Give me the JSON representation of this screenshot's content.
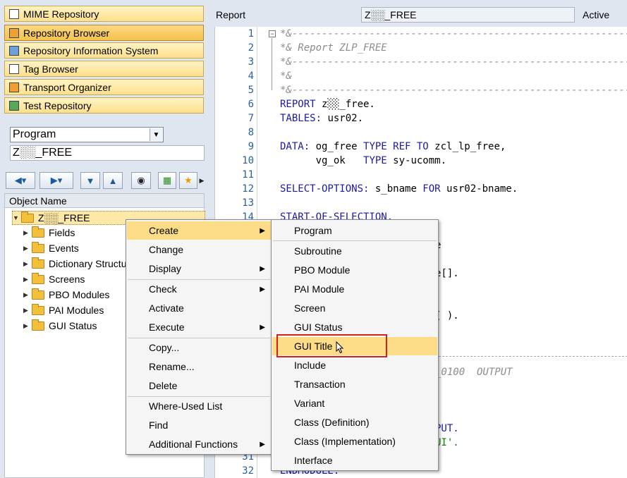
{
  "nav_buttons": [
    {
      "label": "MIME Repository",
      "icon": "mime-icon"
    },
    {
      "label": "Repository Browser",
      "icon": "tree-icon"
    },
    {
      "label": "Repository Information System",
      "icon": "info-system-icon"
    },
    {
      "label": "Tag Browser",
      "icon": "tag-icon"
    },
    {
      "label": "Transport Organizer",
      "icon": "truck-icon"
    },
    {
      "label": "Test Repository",
      "icon": "test-icon"
    }
  ],
  "object_selector": {
    "type_value": "Program",
    "name_value": "Z░░_FREE"
  },
  "tree": {
    "header": "Object Name",
    "root": "Z░░_FREE",
    "nodes": [
      "Fields",
      "Events",
      "Dictionary Structu",
      "Screens",
      "PBO Modules",
      "PAI Modules",
      "GUI Status"
    ]
  },
  "editor_header": {
    "label": "Report",
    "program": "Z░░_FREE",
    "status": "Active"
  },
  "line_numbers": [
    "1",
    "2",
    "3",
    "4",
    "5",
    "6",
    "7",
    "8",
    "9",
    "10",
    "11",
    "12",
    "13",
    "14",
    "31",
    "32"
  ],
  "code": {
    "l1": "*&---------------------------------------------------------------------",
    "l2": "*& Report ZLP_FREE",
    "l3": "*&---------------------------------------------------------------------",
    "l4": "*&",
    "l5": "*&---------------------------------------------------------------------",
    "l6_kw": "REPORT",
    "l6_rest": " z░░_free.",
    "l7_kw": "TABLES:",
    "l7_rest": " usr02.",
    "l9_kw": "DATA:",
    "l9_a": " og_free ",
    "l9_kw2": "TYPE REF TO",
    "l9_b": " zcl_lp_free,",
    "l10_a": "      vg_ok   ",
    "l10_kw": "TYPE",
    "l10_b": " sy-ucomm.",
    "l12_kw": "SELECT-OPTIONS:",
    "l12_a": " s_bname ",
    "l12_kw2": "FOR",
    "l12_b": " usr02-bname.",
    "l14_kw": "START-OF-SELECTION.",
    "p1": "e",
    "p2": "e[].",
    "p3": "( ).",
    "p4": "_0100  OUTPUT",
    "p5": "PUT.",
    "p6": "UI'.",
    "l32_kw": "ENDMODULE."
  },
  "context_menu": {
    "items": [
      {
        "label": "Create",
        "submenu": true
      },
      {
        "label": "Change"
      },
      {
        "label": "Display",
        "submenu": true
      },
      {
        "label": "Check",
        "submenu": true
      },
      {
        "label": "Activate"
      },
      {
        "label": "Execute",
        "submenu": true
      },
      {
        "label": "Copy..."
      },
      {
        "label": "Rename..."
      },
      {
        "label": "Delete"
      },
      {
        "label": "Where-Used List"
      },
      {
        "label": "Find"
      },
      {
        "label": "Additional Functions",
        "submenu": true
      }
    ]
  },
  "create_submenu": {
    "items": [
      "Program",
      "Subroutine",
      "PBO Module",
      "PAI Module",
      "Screen",
      "GUI Status",
      "GUI Title",
      "Include",
      "Transaction",
      "Variant",
      "Class (Definition)",
      "Class (Implementation)",
      "Interface"
    ],
    "highlighted": "GUI Title"
  },
  "colors": {
    "menu_highlight": "#fddc88",
    "focus_frame": "#d02020",
    "keyword": "#1a1aa6",
    "comment": "#8c8c8c"
  }
}
